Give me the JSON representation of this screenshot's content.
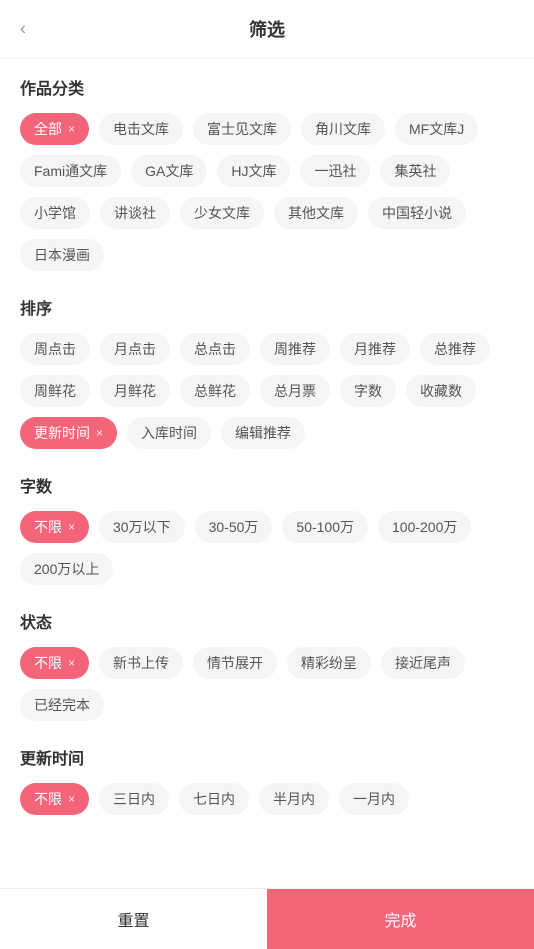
{
  "header": {
    "title": "筛选",
    "back_label": "‹"
  },
  "sections": [
    {
      "id": "category",
      "title": "作品分类",
      "tags": [
        {
          "label": "全部",
          "active": true,
          "closeable": true
        },
        {
          "label": "电击文库",
          "active": false,
          "closeable": false
        },
        {
          "label": "富士见文库",
          "active": false,
          "closeable": false
        },
        {
          "label": "角川文库",
          "active": false,
          "closeable": false
        },
        {
          "label": "MF文库J",
          "active": false,
          "closeable": false
        },
        {
          "label": "Fami通文库",
          "active": false,
          "closeable": false
        },
        {
          "label": "GA文库",
          "active": false,
          "closeable": false
        },
        {
          "label": "HJ文库",
          "active": false,
          "closeable": false
        },
        {
          "label": "一迅社",
          "active": false,
          "closeable": false
        },
        {
          "label": "集英社",
          "active": false,
          "closeable": false
        },
        {
          "label": "小学馆",
          "active": false,
          "closeable": false
        },
        {
          "label": "讲谈社",
          "active": false,
          "closeable": false
        },
        {
          "label": "少女文库",
          "active": false,
          "closeable": false
        },
        {
          "label": "其他文库",
          "active": false,
          "closeable": false
        },
        {
          "label": "中国轻小说",
          "active": false,
          "closeable": false
        },
        {
          "label": "日本漫画",
          "active": false,
          "closeable": false
        }
      ]
    },
    {
      "id": "sort",
      "title": "排序",
      "tags": [
        {
          "label": "周点击",
          "active": false,
          "closeable": false
        },
        {
          "label": "月点击",
          "active": false,
          "closeable": false
        },
        {
          "label": "总点击",
          "active": false,
          "closeable": false
        },
        {
          "label": "周推荐",
          "active": false,
          "closeable": false
        },
        {
          "label": "月推荐",
          "active": false,
          "closeable": false
        },
        {
          "label": "总推荐",
          "active": false,
          "closeable": false
        },
        {
          "label": "周鲜花",
          "active": false,
          "closeable": false
        },
        {
          "label": "月鲜花",
          "active": false,
          "closeable": false
        },
        {
          "label": "总鲜花",
          "active": false,
          "closeable": false
        },
        {
          "label": "总月票",
          "active": false,
          "closeable": false
        },
        {
          "label": "字数",
          "active": false,
          "closeable": false
        },
        {
          "label": "收藏数",
          "active": false,
          "closeable": false
        },
        {
          "label": "更新时间",
          "active": true,
          "closeable": true
        },
        {
          "label": "入库时间",
          "active": false,
          "closeable": false
        },
        {
          "label": "编辑推荐",
          "active": false,
          "closeable": false
        }
      ]
    },
    {
      "id": "wordcount",
      "title": "字数",
      "tags": [
        {
          "label": "不限",
          "active": true,
          "closeable": true
        },
        {
          "label": "30万以下",
          "active": false,
          "closeable": false
        },
        {
          "label": "30-50万",
          "active": false,
          "closeable": false
        },
        {
          "label": "50-100万",
          "active": false,
          "closeable": false
        },
        {
          "label": "100-200万",
          "active": false,
          "closeable": false
        },
        {
          "label": "200万以上",
          "active": false,
          "closeable": false
        }
      ]
    },
    {
      "id": "status",
      "title": "状态",
      "tags": [
        {
          "label": "不限",
          "active": true,
          "closeable": true
        },
        {
          "label": "新书上传",
          "active": false,
          "closeable": false
        },
        {
          "label": "情节展开",
          "active": false,
          "closeable": false
        },
        {
          "label": "精彩纷呈",
          "active": false,
          "closeable": false
        },
        {
          "label": "接近尾声",
          "active": false,
          "closeable": false
        },
        {
          "label": "已经完本",
          "active": false,
          "closeable": false
        }
      ]
    },
    {
      "id": "updatetime",
      "title": "更新时间",
      "tags": [
        {
          "label": "不限",
          "active": true,
          "closeable": true
        },
        {
          "label": "三日内",
          "active": false,
          "closeable": false
        },
        {
          "label": "七日内",
          "active": false,
          "closeable": false
        },
        {
          "label": "半月内",
          "active": false,
          "closeable": false
        },
        {
          "label": "一月内",
          "active": false,
          "closeable": false
        }
      ]
    }
  ],
  "bottom": {
    "reset_label": "重置",
    "confirm_label": "完成"
  },
  "colors": {
    "active_bg": "#f5657a",
    "active_text": "#fff",
    "inactive_bg": "#f5f5f5",
    "inactive_text": "#555"
  }
}
